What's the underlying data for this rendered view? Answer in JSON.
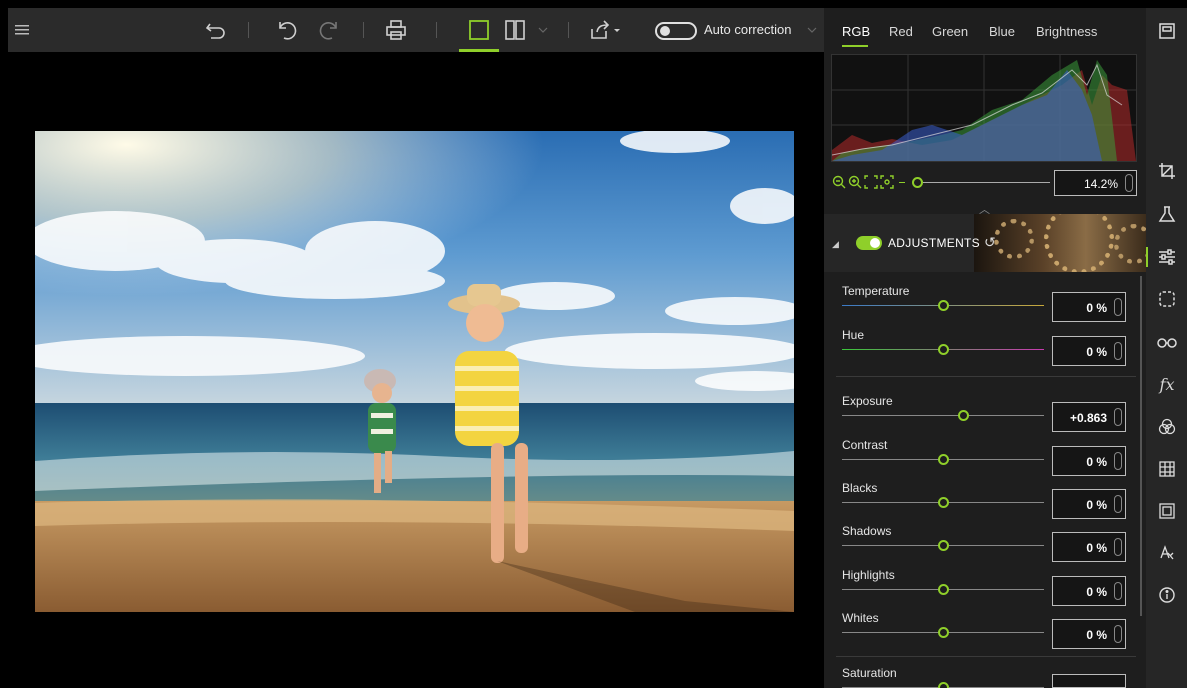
{
  "toolbar": {
    "menu": "menu-icon",
    "auto_correction_label": "Auto correction"
  },
  "histogram": {
    "tabs": [
      "RGB",
      "Red",
      "Green",
      "Blue",
      "Brightness"
    ],
    "active_tab": "RGB",
    "zoom_value": "14.2%"
  },
  "adjustments": {
    "title": "ADJUSTMENTS",
    "enabled": true,
    "sliders": [
      {
        "label": "Temperature",
        "value": "0 %",
        "position": 0.5
      },
      {
        "label": "Hue",
        "value": "0 %",
        "position": 0.5
      },
      {
        "label": "Exposure",
        "value": "+0.863",
        "position": 0.6
      },
      {
        "label": "Contrast",
        "value": "0 %",
        "position": 0.5
      },
      {
        "label": "Blacks",
        "value": "0 %",
        "position": 0.5
      },
      {
        "label": "Shadows",
        "value": "0 %",
        "position": 0.5
      },
      {
        "label": "Highlights",
        "value": "0 %",
        "position": 0.5
      },
      {
        "label": "Whites",
        "value": "0 %",
        "position": 0.5
      },
      {
        "label": "Saturation",
        "value": "",
        "position": 0.5
      }
    ]
  },
  "colors": {
    "accent": "#8fcf2a",
    "panel": "#1e1e1e",
    "toolbar": "#2b2b2b"
  }
}
